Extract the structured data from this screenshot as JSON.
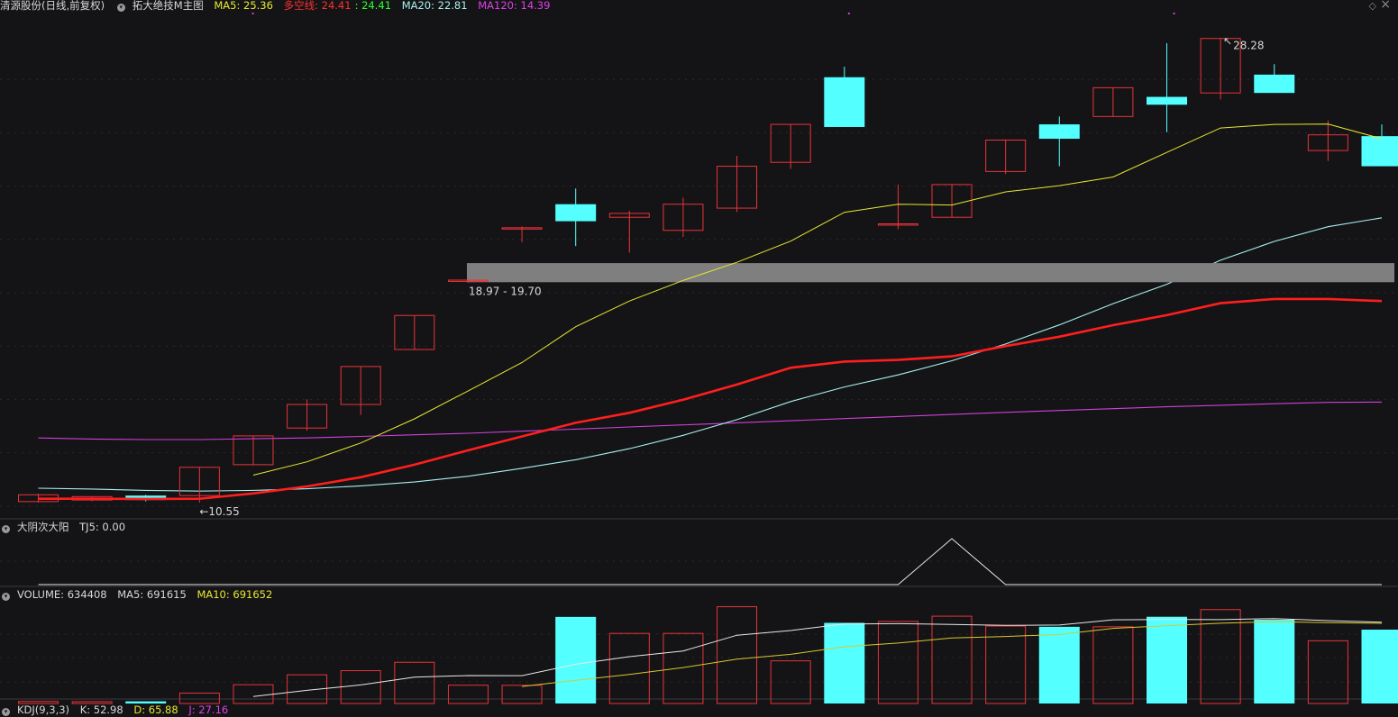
{
  "header": {
    "stock_name": "清源股份",
    "period": "(日线,前复权)",
    "indicator": "拓大绝技M主图",
    "ma5_label": "MA5:",
    "ma5_value": "25.36",
    "dkx_label": "多空线:",
    "dkx_value1": "24.41",
    "dkx_value2": ": 24.41",
    "ma20_label": "MA20:",
    "ma20_value": "22.81",
    "ma120_label": "MA120:",
    "ma120_value": "14.39"
  },
  "window_controls": {
    "diamond": "◇",
    "close": "×"
  },
  "annotations": {
    "high_label": "28.28",
    "low_label": "10.55",
    "zone_label": "18.97 - 19.70"
  },
  "panel2": {
    "title": "大阴次大阳",
    "tj5_label": "TJ5:",
    "tj5_value": "0.00"
  },
  "panel3": {
    "title": "VOLUME:",
    "volume_value": "634408",
    "ma5_label": "MA5:",
    "ma5_value": "691615",
    "ma10_label": "MA10:",
    "ma10_value": "691652"
  },
  "panel4": {
    "title": "KDJ(9,3,3)",
    "k_label": "K:",
    "k_value": "52.98",
    "d_label": "D:",
    "d_value": "65.88",
    "j_label": "J:",
    "j_value": "27.16"
  },
  "colors": {
    "up": "#e8333a",
    "down": "#54ffff",
    "ma5": "#e8e832",
    "dkx": "#ff1e1e",
    "ma20": "#a8f0f0",
    "ma120": "#d040d8",
    "zone": "#7f7f7f",
    "text": "#d8d8d8"
  },
  "chart_data": {
    "type": "candlestick",
    "price_range": [
      10.0,
      29.2
    ],
    "zone": [
      18.97,
      19.7
    ],
    "candles": [
      {
        "o": 10.59,
        "c": 10.85,
        "h": 10.89,
        "l": 10.55
      },
      {
        "o": 10.65,
        "c": 10.78,
        "h": 10.8,
        "l": 10.6
      },
      {
        "o": 10.82,
        "c": 10.65,
        "h": 10.85,
        "l": 10.6
      },
      {
        "o": 10.82,
        "c": 11.9,
        "h": 11.9,
        "l": 10.55
      },
      {
        "o": 12.0,
        "c": 13.1,
        "h": 13.1,
        "l": 12.0
      },
      {
        "o": 13.4,
        "c": 14.3,
        "h": 14.5,
        "l": 13.3
      },
      {
        "o": 14.3,
        "c": 15.75,
        "h": 15.75,
        "l": 13.9
      },
      {
        "o": 16.4,
        "c": 17.7,
        "h": 17.7,
        "l": 16.4
      },
      {
        "o": 19.0,
        "c": 19.05,
        "h": 19.05,
        "l": 18.95
      },
      {
        "o": 21.0,
        "c": 21.05,
        "h": 21.1,
        "l": 20.5
      },
      {
        "o": 21.95,
        "c": 21.3,
        "h": 22.55,
        "l": 20.35
      },
      {
        "o": 21.45,
        "c": 21.6,
        "h": 21.7,
        "l": 20.1
      },
      {
        "o": 20.95,
        "c": 21.95,
        "h": 22.2,
        "l": 20.7
      },
      {
        "o": 21.8,
        "c": 23.4,
        "h": 23.8,
        "l": 21.65
      },
      {
        "o": 23.55,
        "c": 25.0,
        "h": 25.0,
        "l": 23.3
      },
      {
        "o": 26.8,
        "c": 24.9,
        "h": 27.2,
        "l": 24.9
      },
      {
        "o": 21.15,
        "c": 21.2,
        "h": 22.7,
        "l": 21.0
      },
      {
        "o": 21.45,
        "c": 22.7,
        "h": 22.7,
        "l": 21.45
      },
      {
        "o": 23.2,
        "c": 24.4,
        "h": 24.4,
        "l": 23.1
      },
      {
        "o": 25.0,
        "c": 24.45,
        "h": 25.3,
        "l": 23.4
      },
      {
        "o": 25.3,
        "c": 26.4,
        "h": 26.4,
        "l": 25.3
      },
      {
        "o": 26.05,
        "c": 25.75,
        "h": 28.1,
        "l": 24.7
      },
      {
        "o": 26.2,
        "c": 28.28,
        "h": 28.28,
        "l": 25.95
      },
      {
        "o": 26.9,
        "c": 26.2,
        "h": 27.3,
        "l": 26.2
      },
      {
        "o": 24.0,
        "c": 24.6,
        "h": 25.15,
        "l": 23.6
      },
      {
        "o": 24.55,
        "c": 23.4,
        "h": 25.0,
        "l": 23.4
      }
    ],
    "ma5": [
      null,
      null,
      null,
      null,
      11.6,
      12.11,
      12.83,
      13.75,
      14.82,
      15.9,
      17.27,
      18.25,
      19.04,
      19.73,
      20.54,
      21.64,
      21.95,
      21.92,
      22.42,
      22.66,
      22.99,
      23.93,
      24.86,
      25.0,
      25.01,
      24.45
    ],
    "dkx": [
      10.7,
      10.7,
      10.69,
      10.7,
      10.9,
      11.17,
      11.52,
      12.0,
      12.55,
      13.08,
      13.6,
      13.98,
      14.48,
      15.06,
      15.7,
      15.94,
      16.0,
      16.14,
      16.53,
      16.89,
      17.33,
      17.71,
      18.17,
      18.33,
      18.33,
      18.25
    ],
    "ma20": [
      11.1,
      11.07,
      11.02,
      10.99,
      11.02,
      11.08,
      11.19,
      11.34,
      11.56,
      11.86,
      12.19,
      12.61,
      13.12,
      13.72,
      14.41,
      14.97,
      15.43,
      15.97,
      16.61,
      17.34,
      18.15,
      18.89,
      19.81,
      20.53,
      21.09,
      21.43
    ],
    "ma120": [
      13.02,
      12.98,
      12.96,
      12.96,
      12.99,
      13.02,
      13.08,
      13.14,
      13.2,
      13.28,
      13.36,
      13.44,
      13.52,
      13.6,
      13.68,
      13.76,
      13.84,
      13.92,
      14.0,
      14.07,
      14.14,
      14.21,
      14.27,
      14.33,
      14.38,
      14.39
    ],
    "tj5": [
      0,
      0,
      0,
      0,
      0,
      0,
      0,
      0,
      0,
      0,
      0,
      0,
      0,
      0,
      0,
      0,
      0,
      1,
      0,
      0,
      0,
      0,
      0,
      0,
      0,
      0
    ],
    "volume": [
      28000,
      25000,
      30000,
      145000,
      262000,
      400000,
      458000,
      575000,
      255000,
      253000,
      1208000,
      978000,
      978000,
      1350000,
      595000,
      1125000,
      1145000,
      1218000,
      1080000,
      1070000,
      1070000,
      1210000,
      1310000,
      1168000,
      875000,
      1030000
    ],
    "volume_max": 1420000,
    "vol_ma5": [
      null,
      null,
      null,
      null,
      98000,
      184000,
      259000,
      368000,
      390000,
      388000,
      548000,
      654000,
      733000,
      952000,
      1018000,
      1110000,
      1114000,
      1103000,
      1090000,
      1095000,
      1168000,
      1172000,
      1170000,
      1185000,
      1156000,
      1134000
    ],
    "vol_ma10": [
      null,
      null,
      null,
      null,
      null,
      null,
      null,
      null,
      null,
      238000,
      324000,
      406000,
      501000,
      618000,
      686000,
      792000,
      843000,
      913000,
      935000,
      963000,
      1048000,
      1086000,
      1120000,
      1141000,
      1129000,
      1119000
    ]
  }
}
